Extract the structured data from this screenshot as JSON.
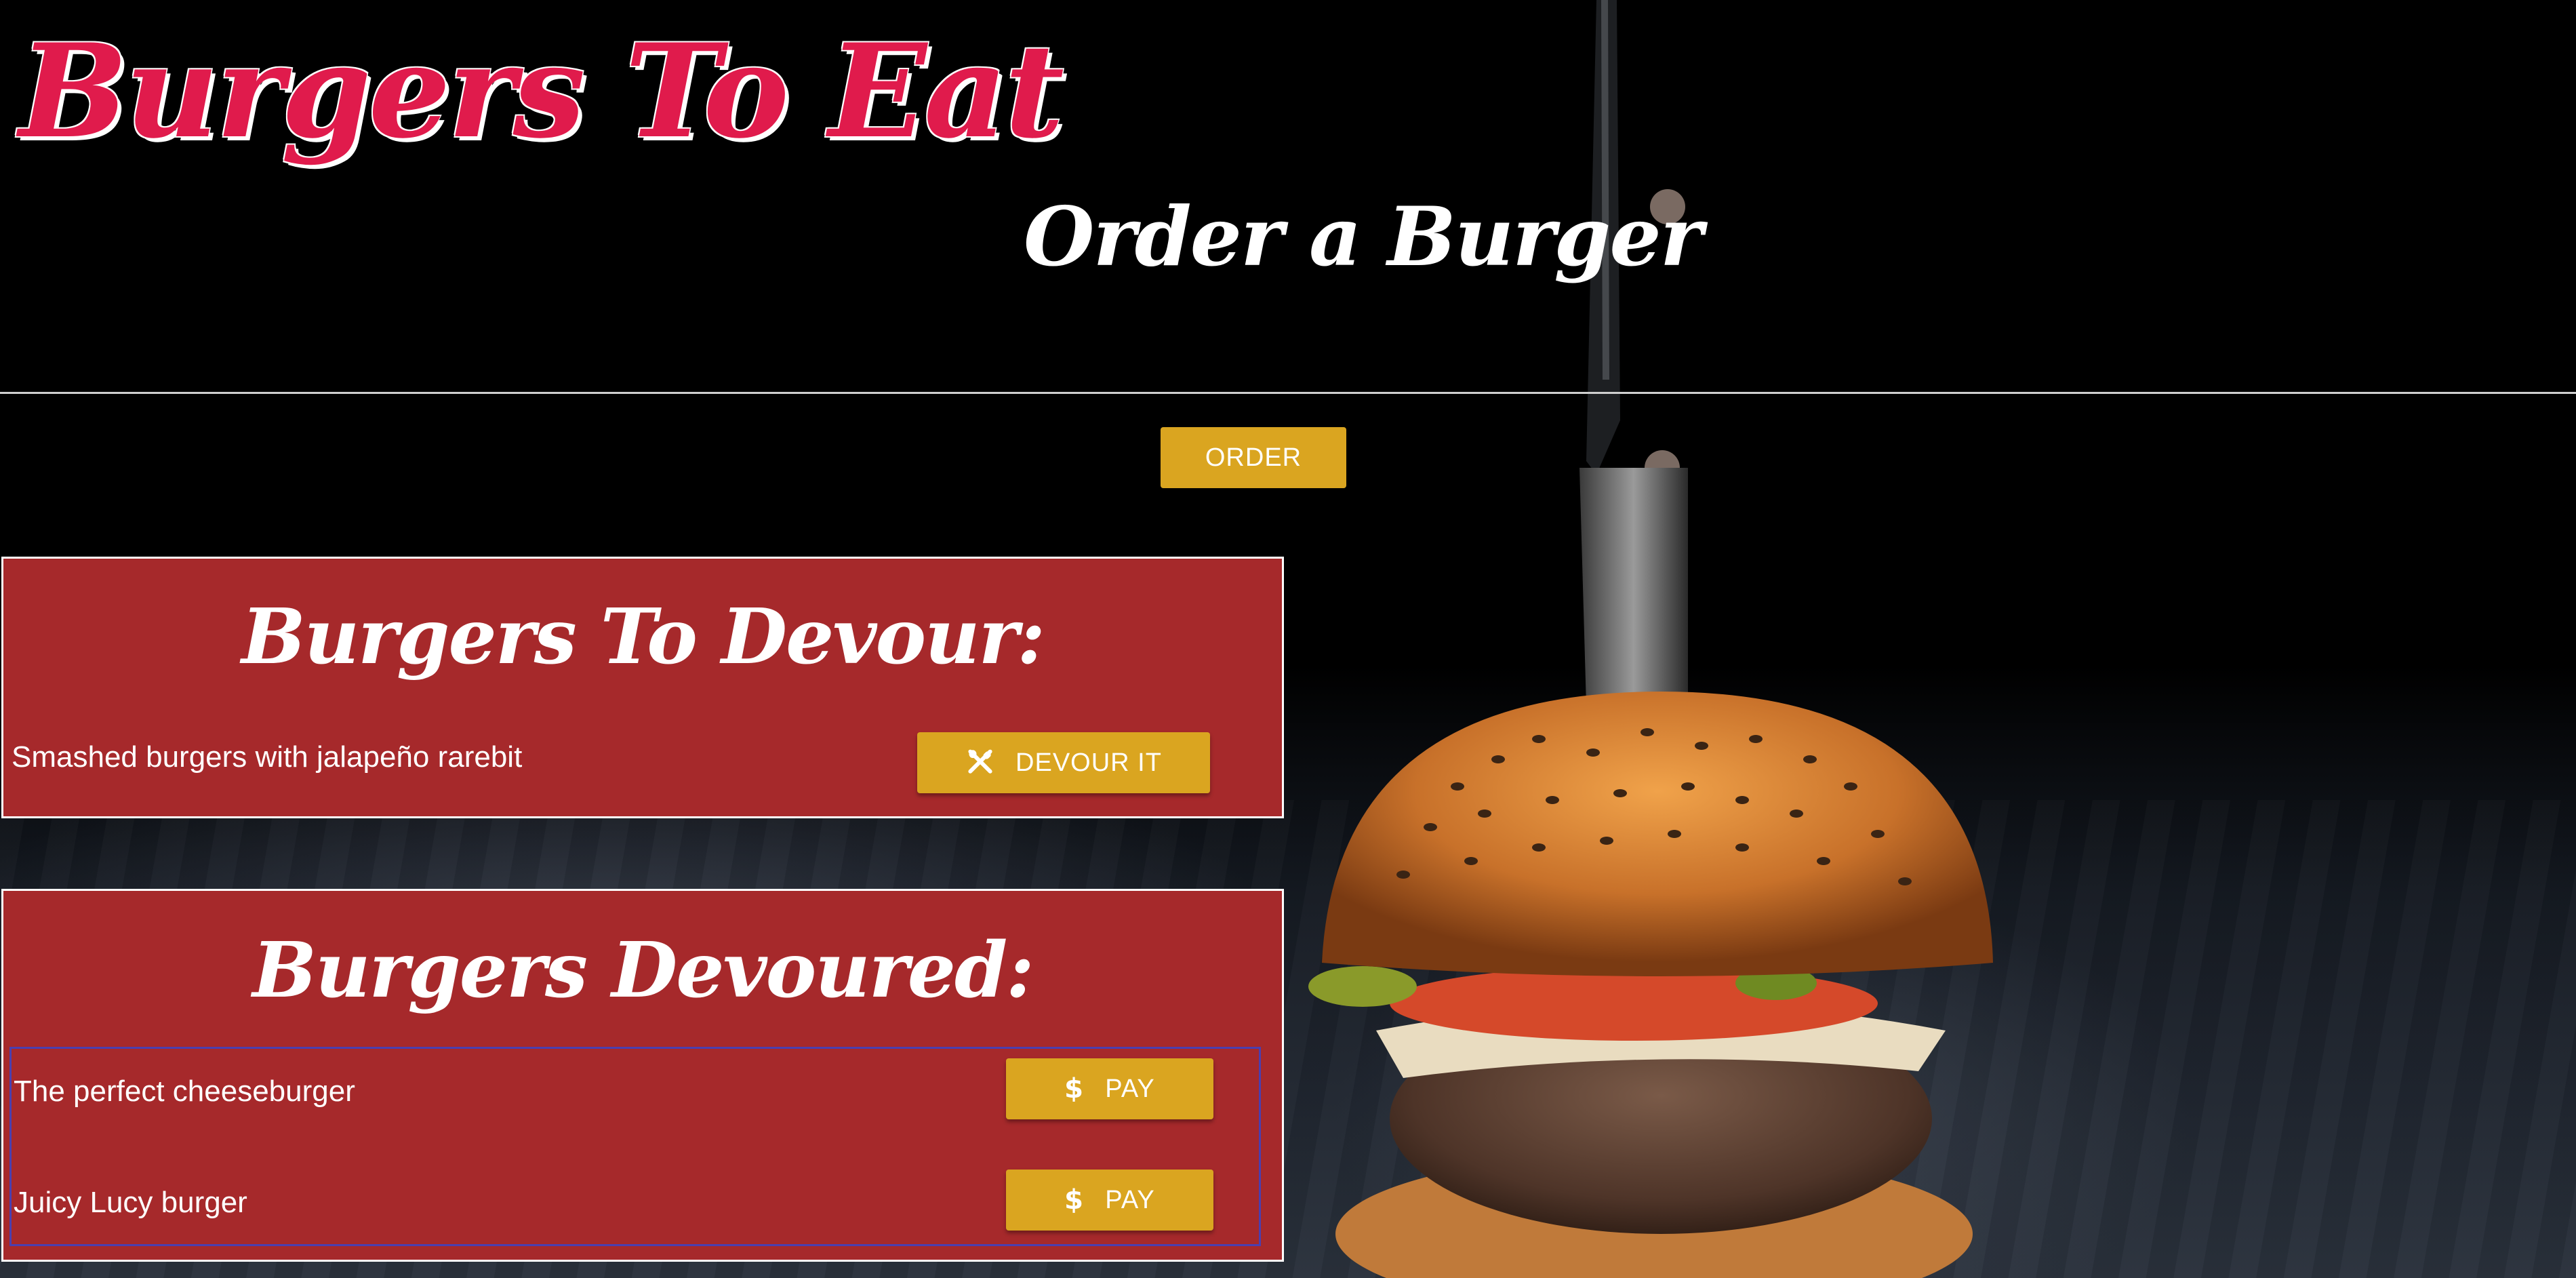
{
  "header": {
    "logo_text": "Burgers To Eat",
    "page_title": "Order a Burger"
  },
  "order": {
    "button_label": "ORDER"
  },
  "undevoured": {
    "heading": "Burgers To Devour:",
    "items": [
      {
        "name": "Smashed burgers with jalapeño rarebit",
        "button_label": "DEVOUR IT",
        "button_icon": "fork-knife-icon"
      }
    ]
  },
  "devoured": {
    "heading": "Burgers Devoured:",
    "items": [
      {
        "name": "The perfect cheeseburger",
        "button_label": "PAY",
        "button_icon": "dollar-icon"
      },
      {
        "name": "Juicy Lucy burger",
        "button_label": "PAY",
        "button_icon": "dollar-icon"
      }
    ]
  },
  "colors": {
    "logo": "#e01b4c",
    "panel_bg": "#a6292b",
    "button_bg": "#daa520",
    "text": "#ffffff",
    "list_border": "#4a3fb0"
  }
}
